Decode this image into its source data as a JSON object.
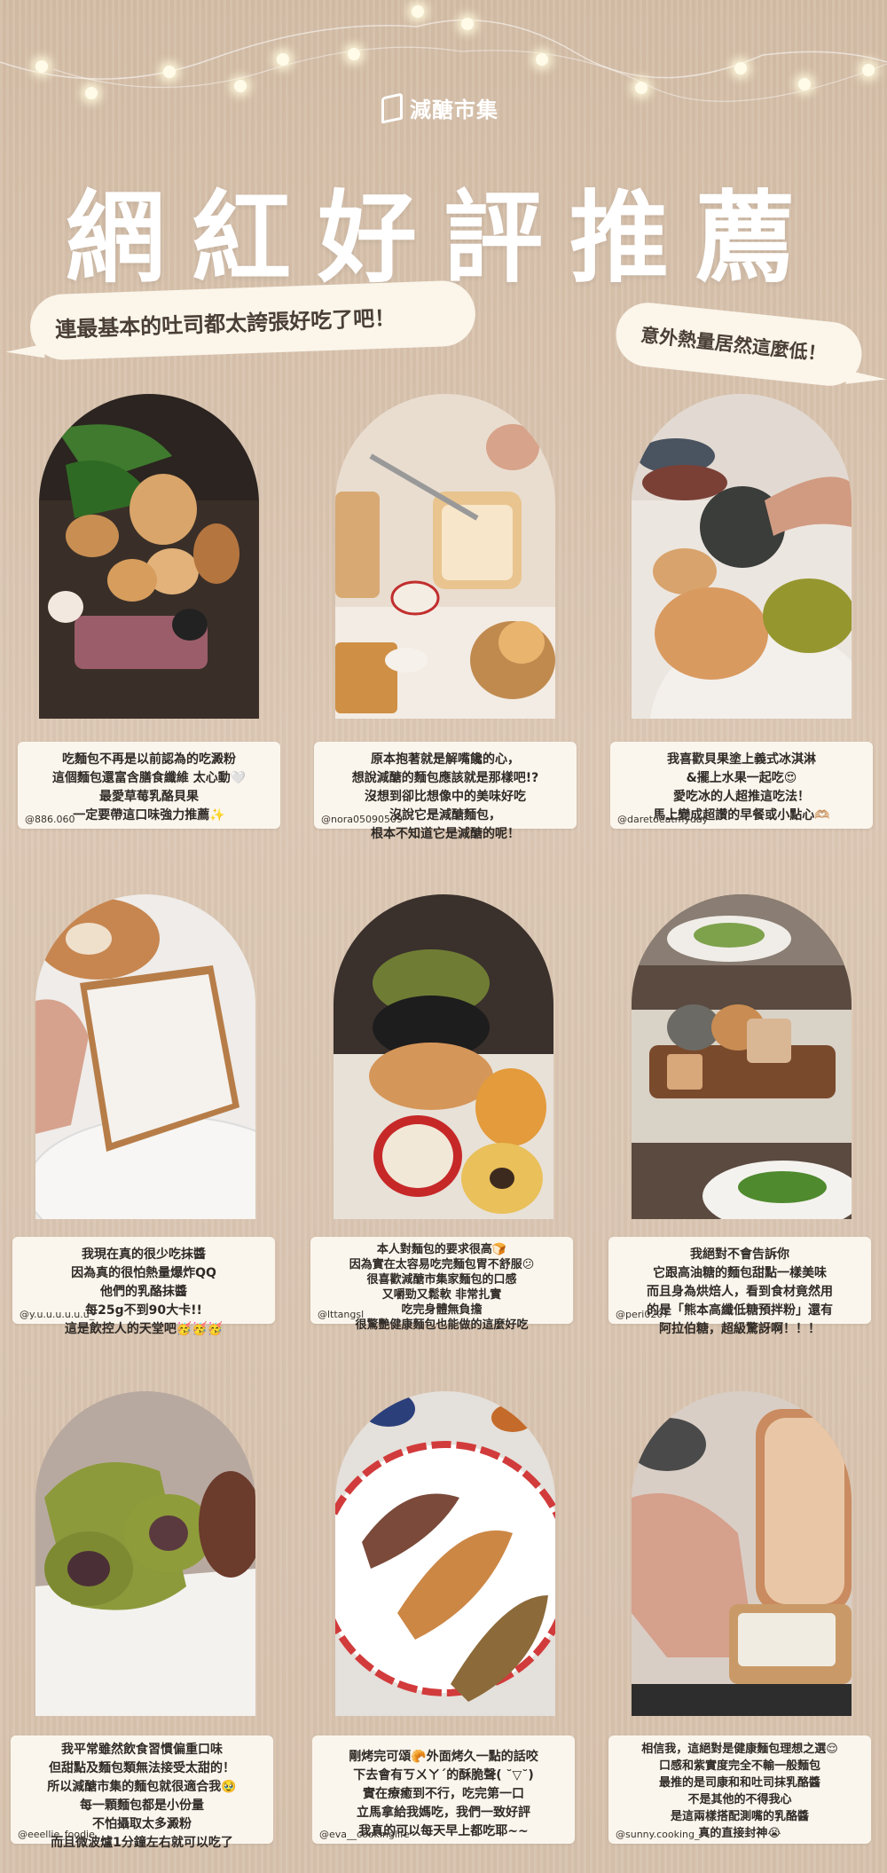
{
  "brand": {
    "name": "減醣市集"
  },
  "title": "網紅好評推薦",
  "bubbles": {
    "left": "連最基本的吐司都太誇張好吃了吧！",
    "right": "意外熱量居然這麼低！"
  },
  "reviews": [
    {
      "lines": [
        "吃麵包不再是以前認為的吃澱粉",
        "這個麵包還富含膳食纖維 太心動🤍",
        "最愛草莓乳酪貝果",
        "一定要帶這口味強力推薦✨"
      ],
      "user": "@886.060"
    },
    {
      "lines": [
        "原本抱著就是解嘴饞的心，",
        "想說減醣的麵包應該就是那樣吧!?",
        "沒想到卻比想像中的美味好吃",
        "沒說它是減醣麵包，",
        "根本不知道它是減醣的呢！"
      ],
      "user": "@nora05090509"
    },
    {
      "lines": [
        "我喜歡貝果塗上義式冰淇淋",
        "&擺上水果一起吃😍",
        "愛吃冰的人超推這吃法！",
        "馬上變成超讚的早餐或小點心🫶🏼"
      ],
      "user": "@daretoeatmyday"
    },
    {
      "lines": [
        "我現在真的很少吃抹醬",
        "因為真的很怕熱量爆炸QQ",
        "他們的乳酪抹醬",
        "每25g不到90大卡!!",
        "這是飲控人的天堂吧🥳🥳🥳"
      ],
      "user": "@y.u.u.u.u.u.u_"
    },
    {
      "lines": [
        "本人對麵包的要求很高🍞",
        "因為實在太容易吃完麵包胃不舒服😕",
        "很喜歡減醣市集家麵包的口感",
        "又嚼勁又鬆軟 非常扎實",
        "吃完身體無負擔",
        "很驚艷健康麵包也能做的這麼好吃"
      ],
      "user": "@lttangsl"
    },
    {
      "lines": [
        "我絕對不會告訴你",
        "它跟高油糖的麵包甜點一樣美味",
        "而且身為烘焙人，看到食材竟然用",
        "的是「熊本高纖低糖預拌粉」還有",
        "阿拉伯糖，超級驚訝啊！！！"
      ],
      "user": "@peri0207"
    },
    {
      "lines": [
        "我平常雖然飲食習慣偏重口味",
        "但甜點及麵包類無法接受太甜的！",
        "所以減醣市集的麵包就很適合我🥹",
        "每一顆麵包都是小份量",
        "不怕攝取太多澱粉",
        "而且微波爐1分鐘左右就可以吃了"
      ],
      "user": "@eeellie_foodie"
    },
    {
      "lines": [
        "剛烤完可頌🥐外面烤久一點的話咬",
        "下去會有ㄎㄨㄚˊ的酥脆聲( ˘▽˘)",
        "實在療癒到不行，吃完第一口",
        "立馬拿給我媽吃，我們一致好評",
        "我真的可以每天早上都吃耶~~"
      ],
      "user": "@eva__cookinglife"
    },
    {
      "lines": [
        "相信我，這絕對是健康麵包理想之選😌",
        "口感和紫實度完全不輸一般麵包",
        "最推的是司康和和吐司抹乳酪醬",
        "不是其他的不得我心",
        "是這兩樣搭配測嘴的乳酪醬",
        "真的直接封神😭"
      ],
      "user": "@sunny.cooking_"
    }
  ]
}
